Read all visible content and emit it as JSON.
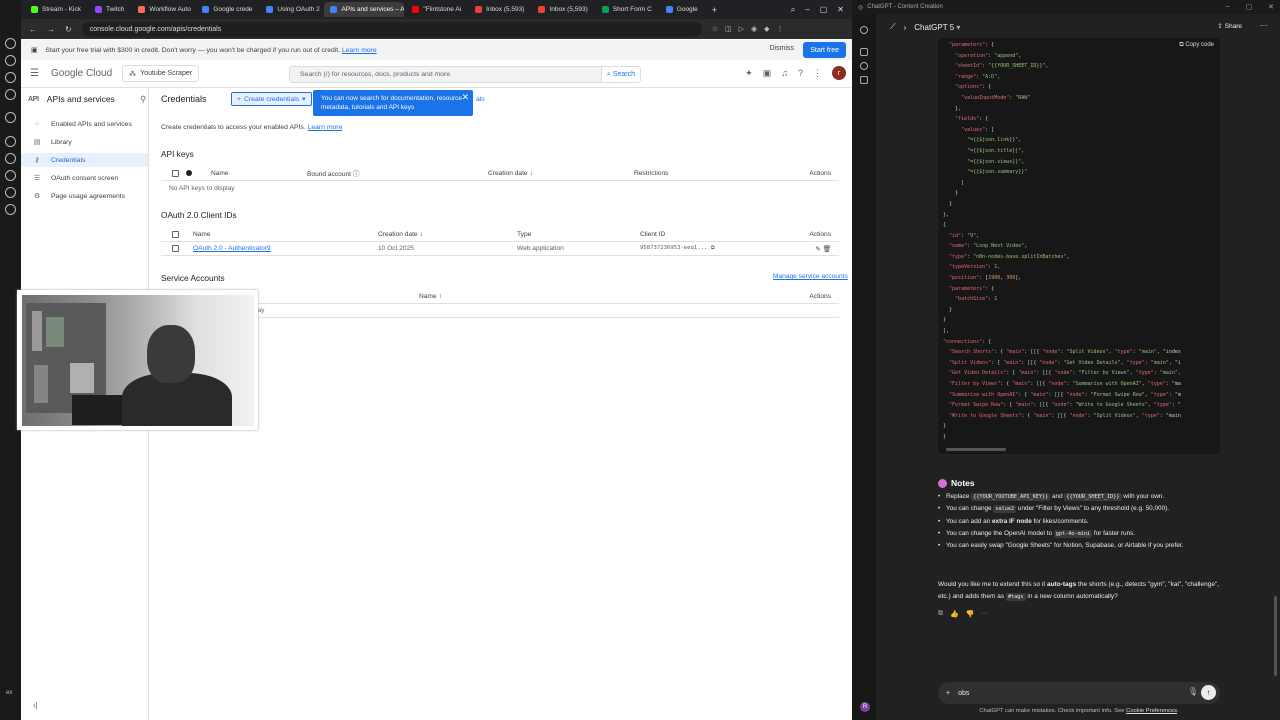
{
  "rail": {
    "bottom_label": "ex"
  },
  "browser": {
    "tabs": [
      {
        "label": "Stream - Kick",
        "color": "#53fc18"
      },
      {
        "label": "Twitch",
        "color": "#9146ff"
      },
      {
        "label": "Workflow Auto",
        "color": "#ff6d5a"
      },
      {
        "label": "Google crede",
        "color": "#4285f4"
      },
      {
        "label": "Using OAuth 2",
        "color": "#4285f4"
      },
      {
        "label": "APIs and services – APIs",
        "color": "#4285f4",
        "active": true
      },
      {
        "label": "\"Flintstone Ai",
        "color": "#ff0000"
      },
      {
        "label": "Inbox (5,593)",
        "color": "#ea4335"
      },
      {
        "label": "Inbox (5,593)",
        "color": "#ea4335"
      },
      {
        "label": "Short Form C",
        "color": "#0f9d58"
      },
      {
        "label": "Google",
        "color": "#4285f4"
      }
    ],
    "url": "console.cloud.google.com/apis/credentials"
  },
  "banner": {
    "text": "Start your free trial with $300 in credit. Don't worry — you won't be charged if you run out of credit.",
    "learn_more": "Learn more",
    "dismiss": "Dismiss",
    "start_free": "Start free"
  },
  "header": {
    "logo_google": "Google",
    "logo_cloud": "Cloud",
    "project": "Youtube Scraper",
    "search_placeholder": "Search (/) for resources, docs, products and more",
    "search_button": "Search",
    "avatar": "r"
  },
  "sidebar": {
    "api_icon": "API",
    "title": "APIs and services",
    "items": [
      {
        "label": "Enabled APIs and services",
        "icon": "grid-icon"
      },
      {
        "label": "Library",
        "icon": "library-icon"
      },
      {
        "label": "Credentials",
        "icon": "key-icon",
        "active": true
      },
      {
        "label": "OAuth consent screen",
        "icon": "consent-icon"
      },
      {
        "label": "Page usage agreements",
        "icon": "settings-icon"
      }
    ]
  },
  "main": {
    "title": "Credentials",
    "create_button": "Create credentials",
    "tooltip": "You can now search for documentation, resource metadata, tutorials and API keys",
    "tooltip_tail": "als",
    "intro": "Create credentials to access your enabled APIs.",
    "intro_link": "Learn more",
    "api_keys": {
      "title": "API keys",
      "columns": [
        "Name",
        "Bound account",
        "Creation date",
        "Restrictions",
        "Actions"
      ],
      "empty": "No API keys to display"
    },
    "oauth": {
      "title": "OAuth 2.0 Client IDs",
      "columns": [
        "Name",
        "Creation date",
        "Type",
        "Client ID",
        "Actions"
      ],
      "row": {
        "name": "OAuth 2.0 - Authenticator9",
        "date": "10 Oct 2025",
        "type": "Web application",
        "client_id": "958737236953-eeq1..."
      }
    },
    "service": {
      "title": "Service Accounts",
      "manage": "Manage service accounts",
      "columns": [
        "Name",
        "Actions"
      ],
      "empty_fragment": "lay"
    }
  },
  "gpt": {
    "window_title": "ChatGPT - Content Creation",
    "model": "ChatGPT 5",
    "share": "Share",
    "copy": "Copy code",
    "notes_title": "Notes",
    "notes": [
      {
        "pre": "Replace ",
        "c1": "{{YOUR_YOUTUBE_API_KEY}}",
        "mid": " and ",
        "c2": "{{YOUR_SHEET_ID}}",
        "post": " with your own."
      },
      {
        "pre": "You can change ",
        "c1": "value2",
        "mid": " under \"Filter by Views\" to any threshold (e.g. 50,000).",
        "c2": "",
        "post": ""
      },
      {
        "pre": "You can add an ",
        "c1": "",
        "mid": "extra IF node",
        "c2": "",
        "post": " for likes/comments."
      },
      {
        "pre": "You can change the OpenAI model to ",
        "c1": "gpt-4o-mini",
        "mid": " for faster runs.",
        "c2": "",
        "post": ""
      },
      {
        "pre": "You can easily swap \"Google Sheets\" for Notion, Supabase, or Airtable if you prefer.",
        "c1": "",
        "mid": "",
        "c2": "",
        "post": ""
      }
    ],
    "question_a": "Would you like me to extend this so it ",
    "question_bold": "auto-tags",
    "question_b": " the shorts (e.g., detects \"gym\", \"kai\", \"challenge\", etc.) and adds them as ",
    "question_code": "#tags",
    "question_c": " in a new column automatically?",
    "composer_text": "obs",
    "disclaimer": "ChatGPT can make mistakes. Check important info. See",
    "disclaimer_link": "Cookie Preferences",
    "avatar": "R",
    "code_lines": [
      "  \"parameters\": {",
      "    \"operation\": \"append\",",
      "    \"sheetId\": \"{{YOUR_SHEET_ID}}\",",
      "    \"range\": \"A:D\",",
      "    \"options\": {",
      "      \"valueInputMode\": \"RAW\"",
      "    },",
      "    \"fields\": {",
      "      \"values\": [",
      "        \"={{$json.link}}\",",
      "        \"={{$json.title}}\",",
      "        \"={{$json.views}}\",",
      "        \"={{$json.summary}}\"",
      "      ]",
      "    }",
      "  }",
      "},",
      "{",
      "  \"id\": \"9\",",
      "  \"name\": \"Loop Next Video\",",
      "  \"type\": \"n8n-nodes-base.splitInBatches\",",
      "  \"typeVersion\": 1,",
      "  \"position\": [1900, 300],",
      "  \"parameters\": {",
      "    \"batchSize\": 1",
      "  }",
      "}",
      "],",
      "\"connections\": {",
      "  \"Search Shorts\": { \"main\": [[{ \"node\": \"Split Videos\", \"type\": \"main\", \"index",
      "  \"Split Videos\": { \"main\": [[{ \"node\": \"Get Video Details\", \"type\": \"main\", \"i",
      "  \"Get Video Details\": { \"main\": [[{ \"node\": \"Filter by Views\", \"type\": \"main\",",
      "  \"Filter by Views\": { \"main\": [[{ \"node\": \"Summarise with OpenAI\", \"type\": \"ma",
      "  \"Summarise with OpenAI\": { \"main\": [[{ \"node\": \"Format Swipe Row\", \"type\": \"m",
      "  \"Format Swipe Row\": { \"main\": [[{ \"node\": \"Write to Google Sheets\", \"type\": \"",
      "  \"Write to Google Sheets\": { \"main\": [[{ \"node\": \"Split Videos\", \"type\": \"main",
      "}",
      "}"
    ]
  }
}
